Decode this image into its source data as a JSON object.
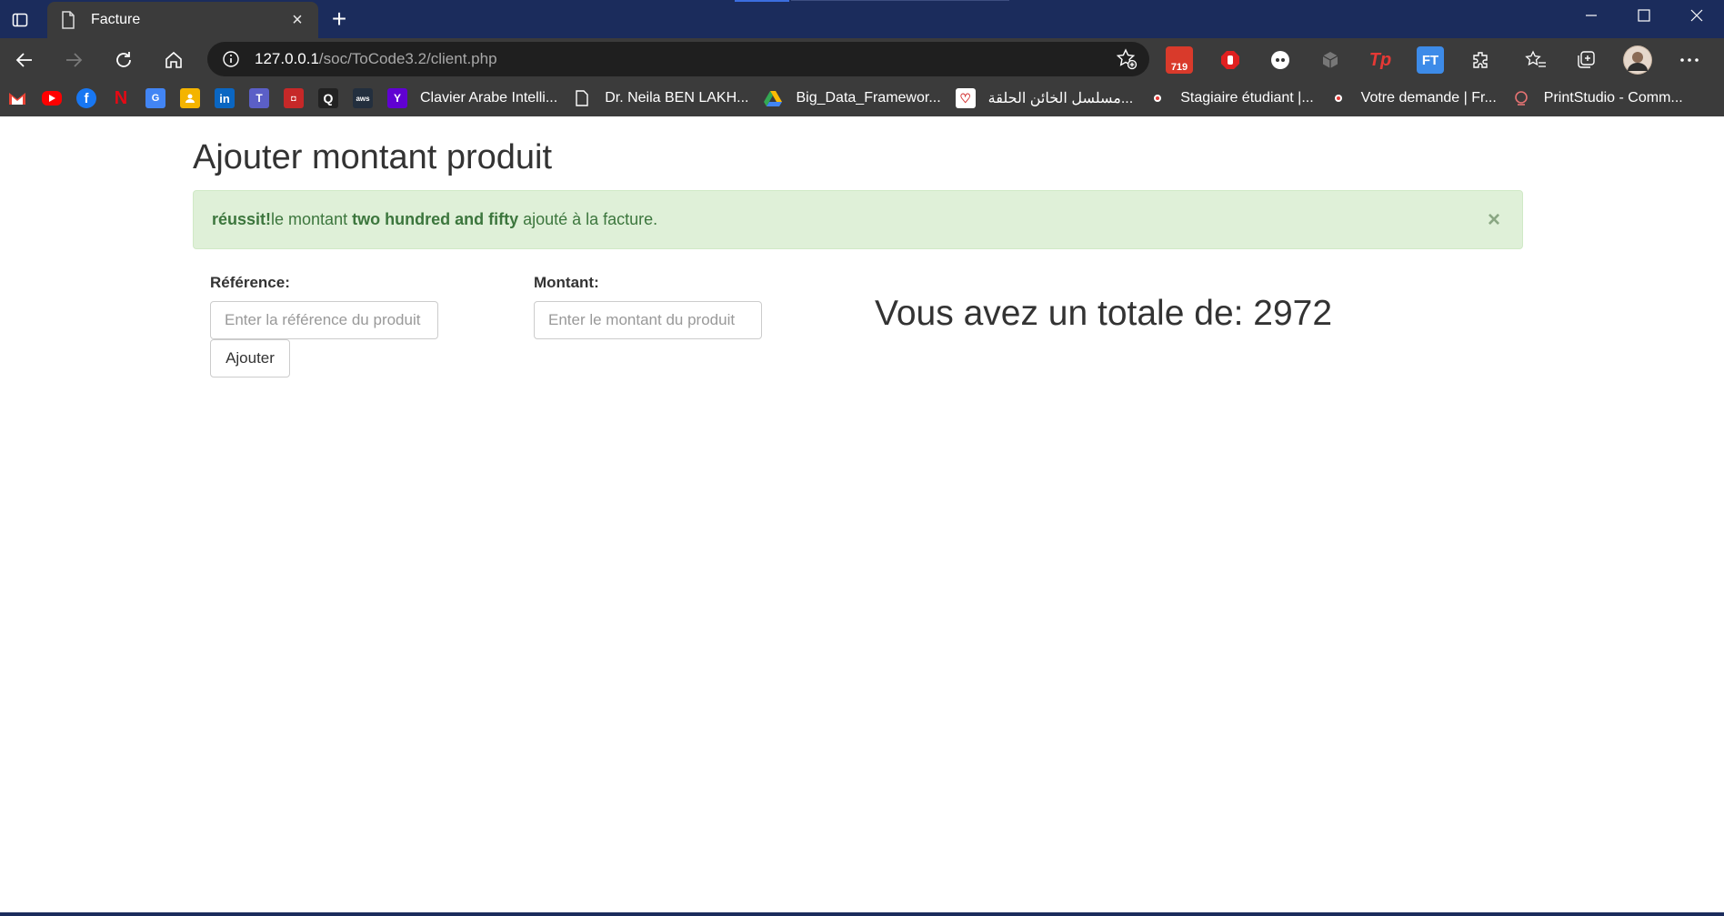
{
  "browser": {
    "tab_title": "Facture",
    "tab_close": "×",
    "new_tab": "+",
    "address_host": "127.0.0.1",
    "address_path": "/soc/ToCode3.2/client.php",
    "extension_badge": "719",
    "extensions": [
      "Tp",
      "FT"
    ],
    "bookmarks": [
      {
        "icon": "gmail-icon",
        "label": ""
      },
      {
        "icon": "youtube-icon",
        "label": ""
      },
      {
        "icon": "facebook-icon",
        "label": ""
      },
      {
        "icon": "netflix-icon",
        "label": ""
      },
      {
        "icon": "google-translate-icon",
        "label": ""
      },
      {
        "icon": "google-classroom-icon",
        "label": ""
      },
      {
        "icon": "linkedin-icon",
        "label": ""
      },
      {
        "icon": "teams-icon",
        "label": ""
      },
      {
        "icon": "app-icon",
        "label": ""
      },
      {
        "icon": "q-icon",
        "label": ""
      },
      {
        "icon": "aws-icon",
        "label": ""
      },
      {
        "icon": "yahoo-icon",
        "label": "Clavier Arabe Intelli..."
      },
      {
        "icon": "document-icon",
        "label": "Dr. Neila BEN LAKH..."
      },
      {
        "icon": "google-drive-icon",
        "label": "Big_Data_Framewor..."
      },
      {
        "icon": "heart-icon",
        "label": "مسلسل الخائن الحلقة..."
      },
      {
        "icon": "bookmark-icon",
        "label": "Stagiaire étudiant |..."
      },
      {
        "icon": "bookmark-icon",
        "label": "Votre demande | Fr..."
      },
      {
        "icon": "printstudio-icon",
        "label": "PrintStudio - Comm..."
      }
    ]
  },
  "page": {
    "title": "Ajouter montant produit",
    "alert": {
      "strong_prefix": "réussit!",
      "text_before": "le montant ",
      "amount_words": "two hundred and fifty",
      "text_after": " ajouté à la facture.",
      "close": "×"
    },
    "form": {
      "reference_label": "Référence:",
      "reference_placeholder": "Enter la référence du produit",
      "amount_label": "Montant:",
      "amount_placeholder": "Enter le montant du produit",
      "submit_label": "Ajouter"
    },
    "total_text": "Vous avez un totale de: 2972"
  }
}
